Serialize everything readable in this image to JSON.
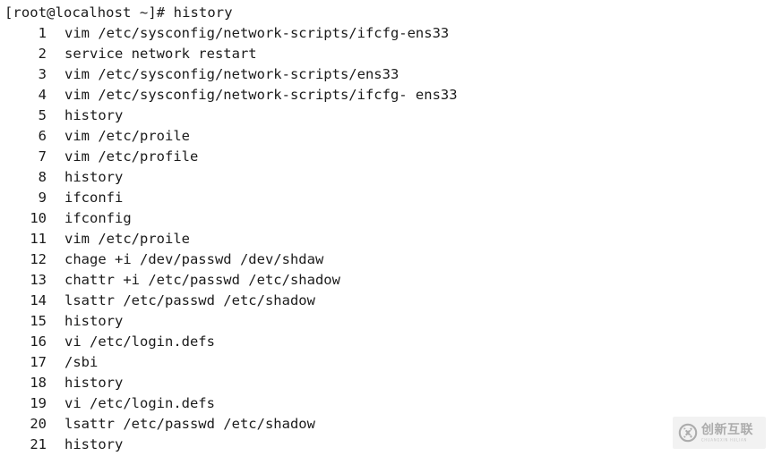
{
  "terminal": {
    "prompt": "[root@localhost ~]# ",
    "command": "history",
    "background_color": "#ffffff",
    "text_color": "#1b1b1b",
    "history": [
      {
        "n": "1",
        "cmd": "vim /etc/sysconfig/network-scripts/ifcfg-ens33"
      },
      {
        "n": "2",
        "cmd": "service network restart"
      },
      {
        "n": "3",
        "cmd": "vim /etc/sysconfig/network-scripts/ens33"
      },
      {
        "n": "4",
        "cmd": "vim /etc/sysconfig/network-scripts/ifcfg- ens33"
      },
      {
        "n": "5",
        "cmd": "history"
      },
      {
        "n": "6",
        "cmd": "vim /etc/proile"
      },
      {
        "n": "7",
        "cmd": "vim /etc/profile"
      },
      {
        "n": "8",
        "cmd": "history"
      },
      {
        "n": "9",
        "cmd": "ifconfi"
      },
      {
        "n": "10",
        "cmd": "ifconfig"
      },
      {
        "n": "11",
        "cmd": "vim /etc/proile"
      },
      {
        "n": "12",
        "cmd": "chage +i /dev/passwd /dev/shdaw"
      },
      {
        "n": "13",
        "cmd": "chattr +i /etc/passwd /etc/shadow"
      },
      {
        "n": "14",
        "cmd": "lsattr /etc/passwd /etc/shadow"
      },
      {
        "n": "15",
        "cmd": "history"
      },
      {
        "n": "16",
        "cmd": "vi /etc/login.defs"
      },
      {
        "n": "17",
        "cmd": "/sbi"
      },
      {
        "n": "18",
        "cmd": "history"
      },
      {
        "n": "19",
        "cmd": "vi /etc/login.defs"
      },
      {
        "n": "20",
        "cmd": "lsattr /etc/passwd /etc/shadow"
      },
      {
        "n": "21",
        "cmd": "history"
      }
    ]
  },
  "watermark": {
    "chinese": "创新互联",
    "pinyin": "CHUANGXIN HULIAN",
    "color": "#a8a8a8",
    "background_color": "#f2f2f2"
  }
}
